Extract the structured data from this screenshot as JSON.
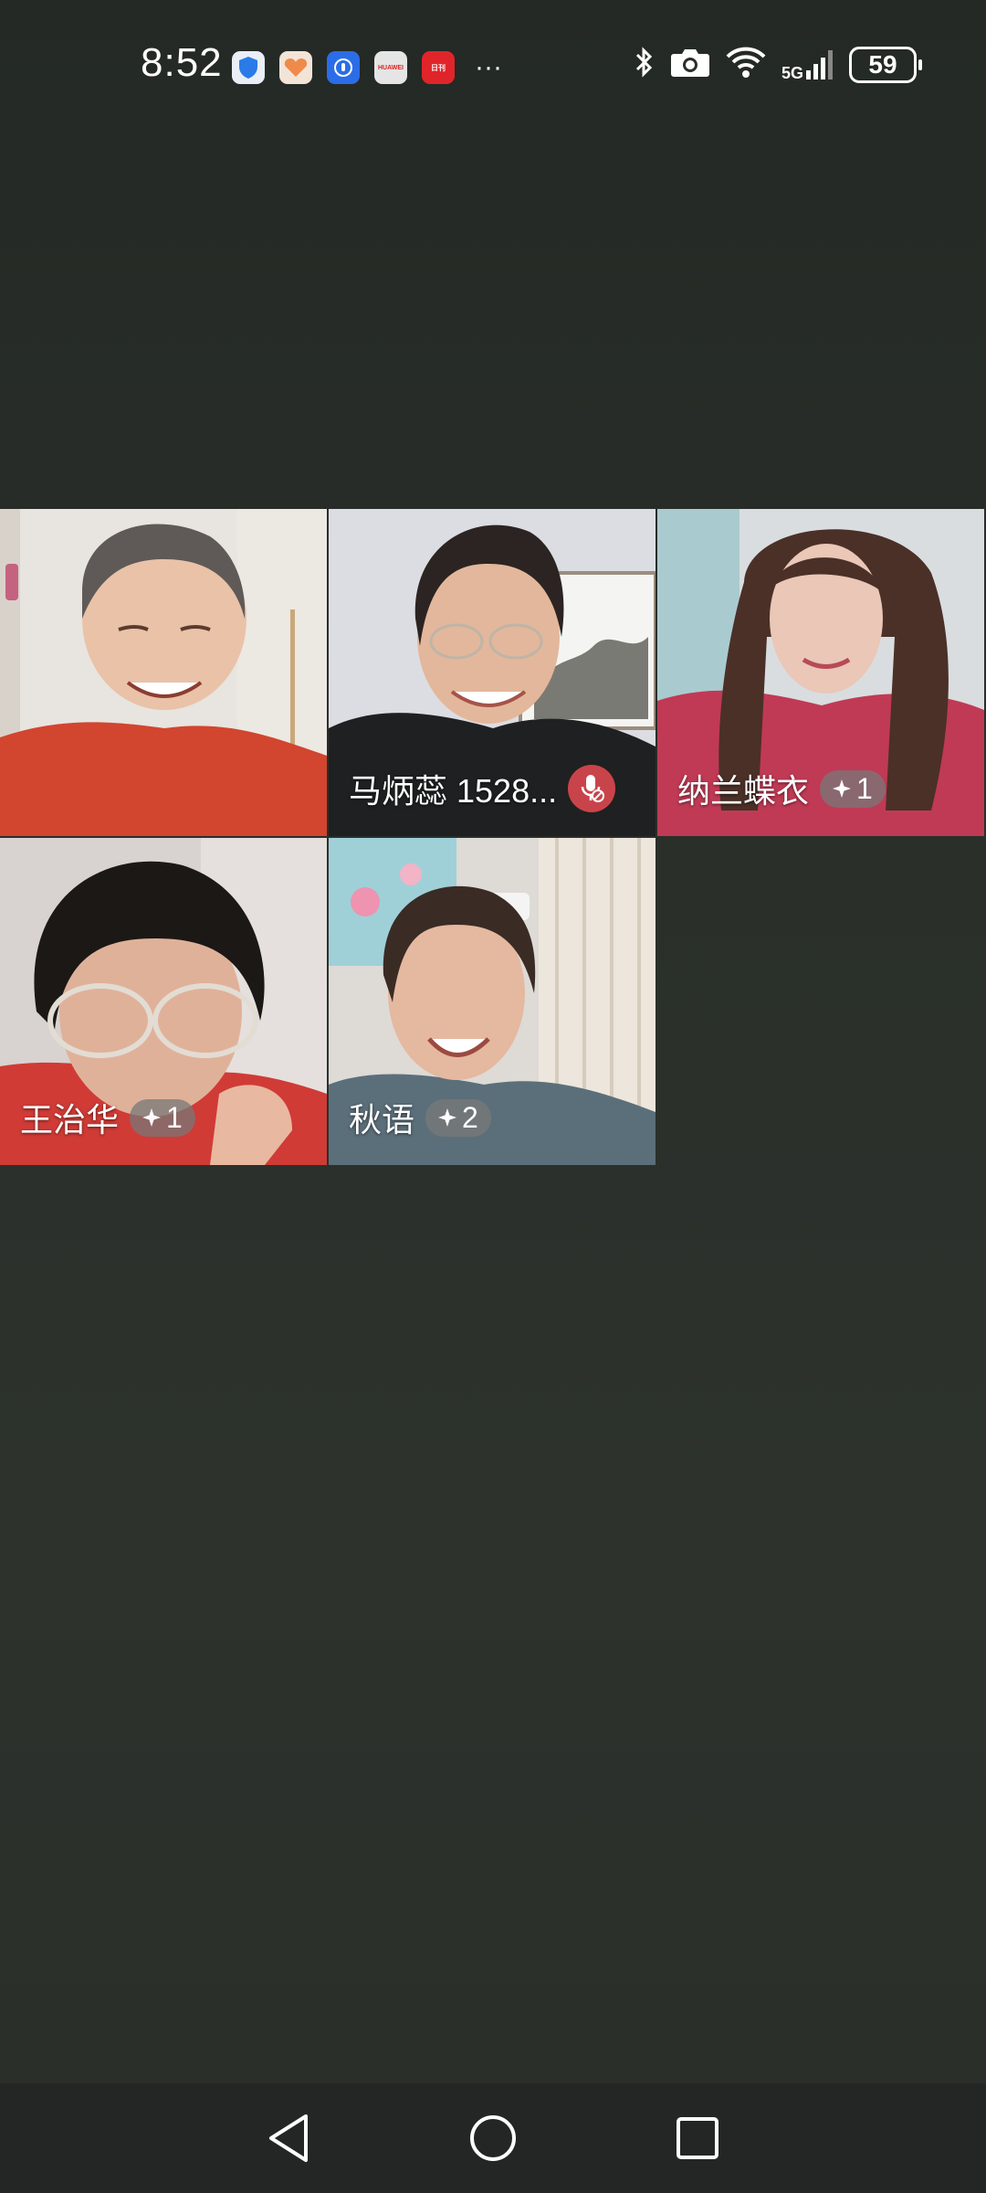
{
  "status_bar": {
    "time": "8:52",
    "notification_icons": [
      "security-shield-icon",
      "heart-app-icon",
      "hand-app-icon",
      "huawei-appgallery-icon",
      "news-app-icon"
    ],
    "huawei_label": "HUAWEI",
    "news_label": "日刊",
    "more": "···",
    "battery": "59",
    "network": "5G",
    "icons": [
      "bluetooth-icon",
      "camera-icon",
      "wifi-icon",
      "cellular-signal-icon",
      "battery-icon"
    ]
  },
  "participants": [
    {
      "name": "",
      "badge": "",
      "muted": false
    },
    {
      "name": "马炳蕊 1528...",
      "badge": "",
      "muted": true
    },
    {
      "name": "纳兰蝶衣",
      "badge": "1",
      "muted": false
    },
    {
      "name": "王治华",
      "badge": "1",
      "muted": false
    },
    {
      "name": "秋语",
      "badge": "2",
      "muted": false
    }
  ],
  "badge_icon": "sparkle-icon",
  "colors": {
    "background": "#2a2f2a",
    "mute_badge": "#c9444a",
    "nav_bar": "#242625"
  },
  "nav": {
    "items": [
      "back-icon",
      "home-icon",
      "recents-icon"
    ]
  }
}
